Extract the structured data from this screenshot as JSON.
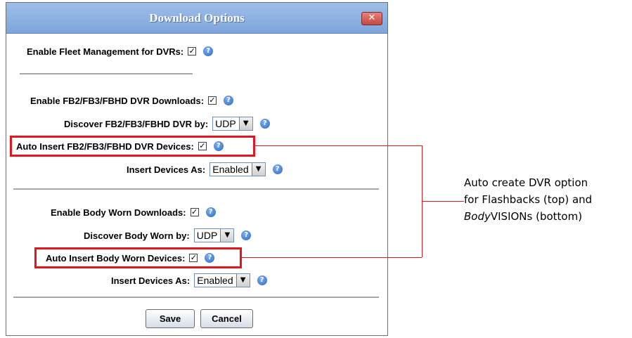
{
  "dialog": {
    "title": "Download Options",
    "close_icon": "close-icon"
  },
  "settings": {
    "fleet_label": "Enable Fleet Management for DVRs:",
    "fb_downloads_label": "Enable FB2/FB3/FBHD DVR Downloads:",
    "fb_discover_label": "Discover FB2/FB3/FBHD DVR by:",
    "fb_discover_value": "UDP",
    "fb_auto_insert_label": "Auto Insert FB2/FB3/FBHD DVR Devices:",
    "fb_insert_as_label": "Insert Devices As:",
    "fb_insert_as_value": "Enabled",
    "bw_downloads_label": "Enable Body Worn Downloads:",
    "bw_discover_label": "Discover Body Worn by:",
    "bw_discover_value": "UDP",
    "bw_auto_insert_label": "Auto Insert Body Worn Devices:",
    "bw_insert_as_label": "Insert Devices As:",
    "bw_insert_as_value": "Enabled",
    "checked_mark": "✓",
    "help_mark": "?",
    "dropdown_arrow": "▼"
  },
  "buttons": {
    "save": "Save",
    "cancel": "Cancel"
  },
  "annotation": {
    "line1": "Auto create DVR option",
    "line2": "for Flashbacks (top) and",
    "line3_italic": "Body",
    "line3_rest": "VISIONs (bottom)"
  },
  "colors": {
    "highlight": "#e2161c",
    "titlebar": "#8fb1e3"
  }
}
